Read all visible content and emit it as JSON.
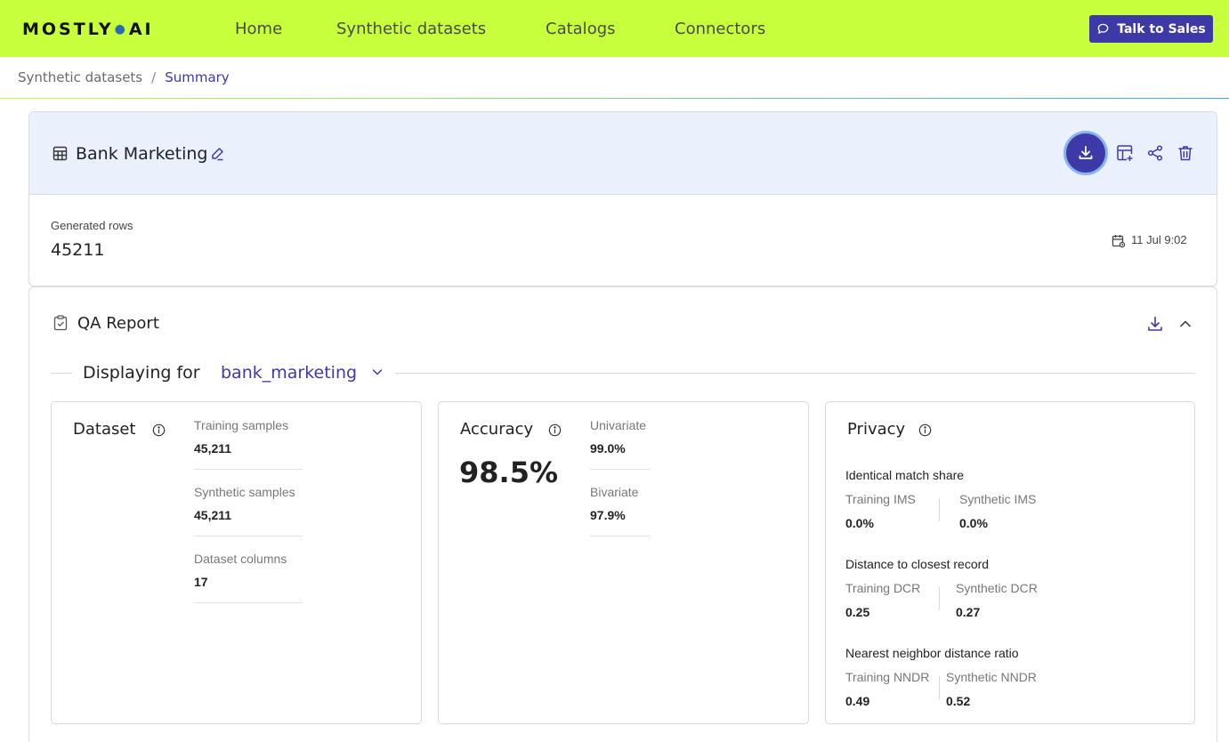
{
  "header": {
    "logo_left": "MOSTLY",
    "logo_dot": "●",
    "logo_right": "AI",
    "nav": [
      "Home",
      "Synthetic datasets",
      "Catalogs",
      "Connectors"
    ],
    "sales_button": "Talk to Sales",
    "bg_color": "#c8ff3c",
    "accent_color": "#3d3aa8"
  },
  "breadcrumb": {
    "parent": "Synthetic datasets",
    "separator": "/",
    "current": "Summary"
  },
  "dataset": {
    "title": "Bank Marketing",
    "generated_rows_label": "Generated rows",
    "generated_rows_value": "45211",
    "date": "11 Jul 9:02",
    "icons": [
      "table-icon",
      "edit-icon",
      "download-icon",
      "add-table-icon",
      "share-icon",
      "trash-icon",
      "calendar-icon"
    ]
  },
  "qa_report": {
    "title": "QA Report",
    "displaying_label": "Displaying for",
    "displaying_value": "bank_marketing",
    "dataset_panel": {
      "title": "Dataset",
      "metrics": [
        {
          "label": "Training samples",
          "value": "45,211"
        },
        {
          "label": "Synthetic samples",
          "value": "45,211"
        },
        {
          "label": "Dataset columns",
          "value": "17"
        }
      ]
    },
    "accuracy_panel": {
      "title": "Accuracy",
      "overall": "98.5%",
      "metrics": [
        {
          "label": "Univariate",
          "value": "99.0%"
        },
        {
          "label": "Bivariate",
          "value": "97.9%"
        }
      ]
    },
    "privacy_panel": {
      "title": "Privacy",
      "sections": [
        {
          "title": "Identical match share",
          "left_label": "Training IMS",
          "left_value": "0.0%",
          "right_label": "Synthetic IMS",
          "right_value": "0.0%"
        },
        {
          "title": "Distance to closest record",
          "left_label": "Training DCR",
          "left_value": "0.25",
          "right_label": "Synthetic DCR",
          "right_value": "0.27"
        },
        {
          "title": "Nearest neighbor distance ratio",
          "left_label": "Training NNDR",
          "left_value": "0.49",
          "right_label": "Synthetic NNDR",
          "right_value": "0.52"
        }
      ]
    }
  }
}
